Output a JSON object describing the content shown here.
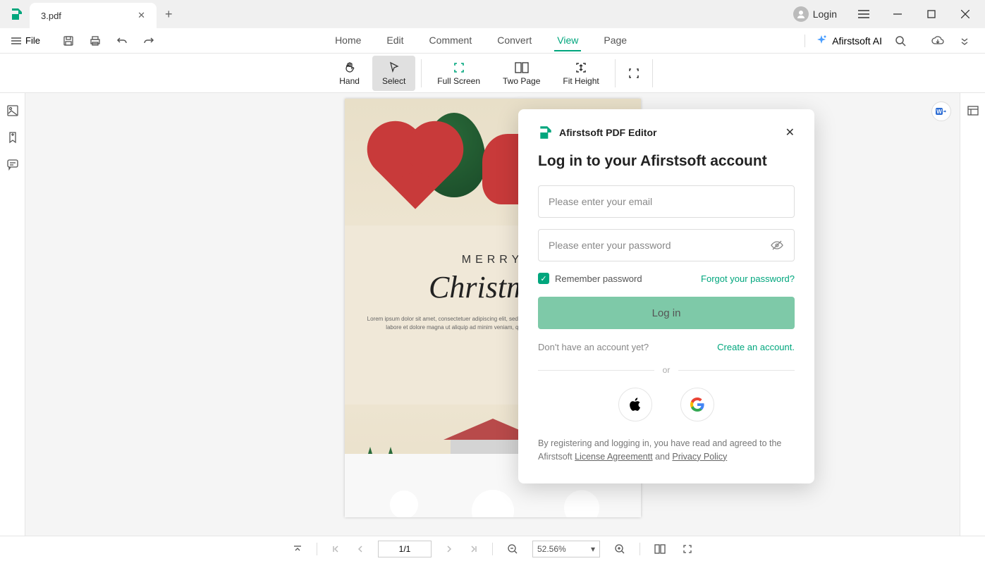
{
  "titlebar": {
    "tab_name": "3.pdf",
    "login_label": "Login"
  },
  "menubar": {
    "file_label": "File",
    "items": [
      "Home",
      "Edit",
      "Comment",
      "Convert",
      "View",
      "Page"
    ],
    "active": "View",
    "ai_label": "Afirstsoft AI"
  },
  "view_toolbar": {
    "hand": "Hand",
    "select": "Select",
    "fullscreen": "Full Screen",
    "twopage": "Two Page",
    "fitheight": "Fit Height"
  },
  "document": {
    "merry": "MERRY",
    "christmas": "Christmas",
    "lorem": "Lorem ipsum dolor sit amet, consectetuer adipiscing elit, sed diam nibh eiusmod tempor incididunt ut labore et dolore magna ut aliquip ad minim veniam, quis nostrud exercitation ullamco."
  },
  "statusbar": {
    "page_display": "1/1",
    "zoom": "52.56%"
  },
  "modal": {
    "brand": "Afirstsoft PDF Editor",
    "heading": "Log in to your Afirstsoft account",
    "email_placeholder": "Please enter your email",
    "password_placeholder": "Please enter your password",
    "remember": "Remember password",
    "forgot": "Forgot your password?",
    "login_btn": "Log in",
    "no_account": "Don't have an account yet?",
    "create": "Create an account.",
    "or": "or",
    "terms_prefix": "By registering and logging in, you have read and agreed to the Afirstsoft ",
    "license": "License Agreementt",
    "and": " and ",
    "privacy": "Privacy Policy"
  }
}
